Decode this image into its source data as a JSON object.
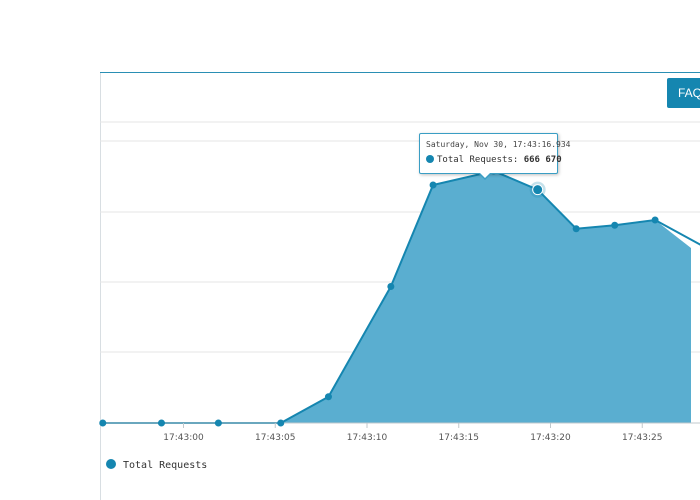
{
  "faq_button": {
    "label": "FAQ"
  },
  "colors": {
    "series": "#1586b0",
    "area_fill": "#5aaed0",
    "grid": "#e6e6e6"
  },
  "chart_data": {
    "type": "area",
    "x_tick_labels": [
      "17:43:00",
      "17:43:05",
      "17:43:10",
      "17:43:15",
      "17:43:20",
      "17:43:25"
    ],
    "x_tick_seconds": [
      0,
      5,
      10,
      15,
      20,
      25
    ],
    "ylim": [
      0,
      1000000
    ],
    "grid": true,
    "legend_placement": "bottom-left",
    "series": [
      {
        "name": "Total Requests",
        "x_seconds": [
          -4.4,
          -1.2,
          1.9,
          5.3,
          7.9,
          11.3,
          13.6,
          16.9,
          19.3,
          21.4,
          23.5,
          25.7,
          28.5
        ],
        "values": [
          0,
          0,
          0,
          0,
          75000,
          390000,
          680000,
          720000,
          666670,
          555000,
          565000,
          580000,
          500000
        ]
      }
    ],
    "tooltip": {
      "date": "Saturday, Nov 30, 17:43:16.934",
      "series": "Total Requests",
      "value": "666 670"
    }
  }
}
